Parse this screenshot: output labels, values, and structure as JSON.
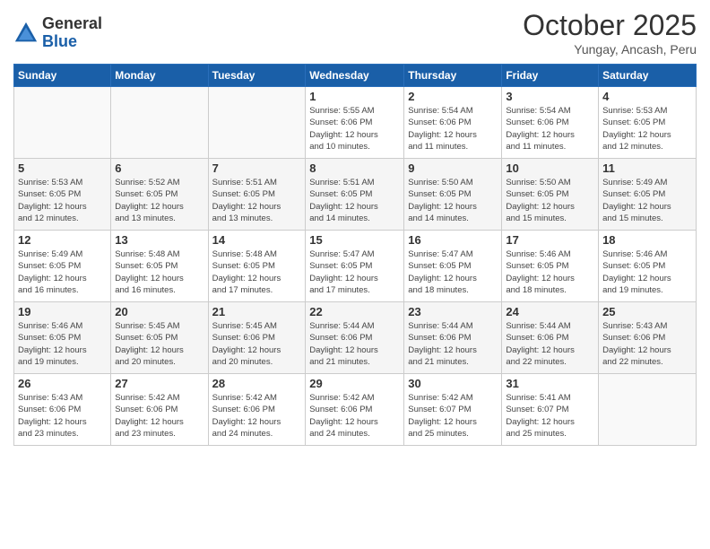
{
  "logo": {
    "general": "General",
    "blue": "Blue"
  },
  "header": {
    "month": "October 2025",
    "location": "Yungay, Ancash, Peru"
  },
  "weekdays": [
    "Sunday",
    "Monday",
    "Tuesday",
    "Wednesday",
    "Thursday",
    "Friday",
    "Saturday"
  ],
  "weeks": [
    [
      {
        "day": "",
        "info": ""
      },
      {
        "day": "",
        "info": ""
      },
      {
        "day": "",
        "info": ""
      },
      {
        "day": "1",
        "info": "Sunrise: 5:55 AM\nSunset: 6:06 PM\nDaylight: 12 hours\nand 10 minutes."
      },
      {
        "day": "2",
        "info": "Sunrise: 5:54 AM\nSunset: 6:06 PM\nDaylight: 12 hours\nand 11 minutes."
      },
      {
        "day": "3",
        "info": "Sunrise: 5:54 AM\nSunset: 6:06 PM\nDaylight: 12 hours\nand 11 minutes."
      },
      {
        "day": "4",
        "info": "Sunrise: 5:53 AM\nSunset: 6:05 PM\nDaylight: 12 hours\nand 12 minutes."
      }
    ],
    [
      {
        "day": "5",
        "info": "Sunrise: 5:53 AM\nSunset: 6:05 PM\nDaylight: 12 hours\nand 12 minutes."
      },
      {
        "day": "6",
        "info": "Sunrise: 5:52 AM\nSunset: 6:05 PM\nDaylight: 12 hours\nand 13 minutes."
      },
      {
        "day": "7",
        "info": "Sunrise: 5:51 AM\nSunset: 6:05 PM\nDaylight: 12 hours\nand 13 minutes."
      },
      {
        "day": "8",
        "info": "Sunrise: 5:51 AM\nSunset: 6:05 PM\nDaylight: 12 hours\nand 14 minutes."
      },
      {
        "day": "9",
        "info": "Sunrise: 5:50 AM\nSunset: 6:05 PM\nDaylight: 12 hours\nand 14 minutes."
      },
      {
        "day": "10",
        "info": "Sunrise: 5:50 AM\nSunset: 6:05 PM\nDaylight: 12 hours\nand 15 minutes."
      },
      {
        "day": "11",
        "info": "Sunrise: 5:49 AM\nSunset: 6:05 PM\nDaylight: 12 hours\nand 15 minutes."
      }
    ],
    [
      {
        "day": "12",
        "info": "Sunrise: 5:49 AM\nSunset: 6:05 PM\nDaylight: 12 hours\nand 16 minutes."
      },
      {
        "day": "13",
        "info": "Sunrise: 5:48 AM\nSunset: 6:05 PM\nDaylight: 12 hours\nand 16 minutes."
      },
      {
        "day": "14",
        "info": "Sunrise: 5:48 AM\nSunset: 6:05 PM\nDaylight: 12 hours\nand 17 minutes."
      },
      {
        "day": "15",
        "info": "Sunrise: 5:47 AM\nSunset: 6:05 PM\nDaylight: 12 hours\nand 17 minutes."
      },
      {
        "day": "16",
        "info": "Sunrise: 5:47 AM\nSunset: 6:05 PM\nDaylight: 12 hours\nand 18 minutes."
      },
      {
        "day": "17",
        "info": "Sunrise: 5:46 AM\nSunset: 6:05 PM\nDaylight: 12 hours\nand 18 minutes."
      },
      {
        "day": "18",
        "info": "Sunrise: 5:46 AM\nSunset: 6:05 PM\nDaylight: 12 hours\nand 19 minutes."
      }
    ],
    [
      {
        "day": "19",
        "info": "Sunrise: 5:46 AM\nSunset: 6:05 PM\nDaylight: 12 hours\nand 19 minutes."
      },
      {
        "day": "20",
        "info": "Sunrise: 5:45 AM\nSunset: 6:05 PM\nDaylight: 12 hours\nand 20 minutes."
      },
      {
        "day": "21",
        "info": "Sunrise: 5:45 AM\nSunset: 6:06 PM\nDaylight: 12 hours\nand 20 minutes."
      },
      {
        "day": "22",
        "info": "Sunrise: 5:44 AM\nSunset: 6:06 PM\nDaylight: 12 hours\nand 21 minutes."
      },
      {
        "day": "23",
        "info": "Sunrise: 5:44 AM\nSunset: 6:06 PM\nDaylight: 12 hours\nand 21 minutes."
      },
      {
        "day": "24",
        "info": "Sunrise: 5:44 AM\nSunset: 6:06 PM\nDaylight: 12 hours\nand 22 minutes."
      },
      {
        "day": "25",
        "info": "Sunrise: 5:43 AM\nSunset: 6:06 PM\nDaylight: 12 hours\nand 22 minutes."
      }
    ],
    [
      {
        "day": "26",
        "info": "Sunrise: 5:43 AM\nSunset: 6:06 PM\nDaylight: 12 hours\nand 23 minutes."
      },
      {
        "day": "27",
        "info": "Sunrise: 5:42 AM\nSunset: 6:06 PM\nDaylight: 12 hours\nand 23 minutes."
      },
      {
        "day": "28",
        "info": "Sunrise: 5:42 AM\nSunset: 6:06 PM\nDaylight: 12 hours\nand 24 minutes."
      },
      {
        "day": "29",
        "info": "Sunrise: 5:42 AM\nSunset: 6:06 PM\nDaylight: 12 hours\nand 24 minutes."
      },
      {
        "day": "30",
        "info": "Sunrise: 5:42 AM\nSunset: 6:07 PM\nDaylight: 12 hours\nand 25 minutes."
      },
      {
        "day": "31",
        "info": "Sunrise: 5:41 AM\nSunset: 6:07 PM\nDaylight: 12 hours\nand 25 minutes."
      },
      {
        "day": "",
        "info": ""
      }
    ]
  ]
}
